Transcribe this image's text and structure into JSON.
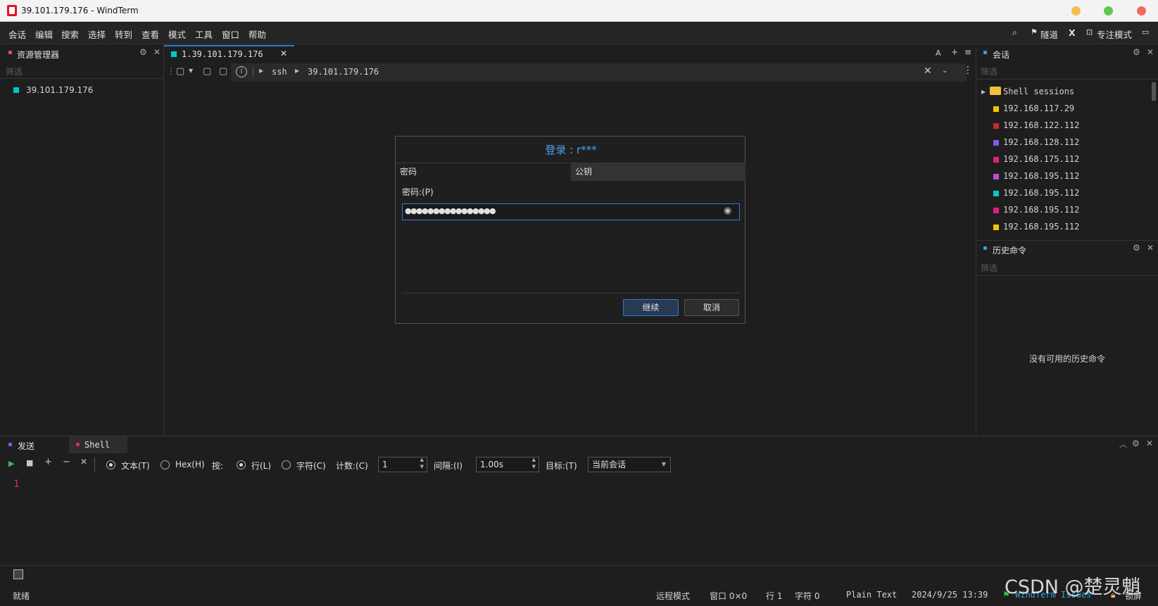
{
  "window": {
    "title": "39.101.179.176 - WindTerm"
  },
  "menu": {
    "items": [
      "会话",
      "编辑",
      "搜索",
      "选择",
      "转到",
      "查看",
      "模式",
      "工具",
      "窗口",
      "帮助"
    ],
    "tunnel_label": "隧道",
    "x_label": "X",
    "focus_label": "专注模式"
  },
  "explorer": {
    "title": "资源管理器",
    "filter_placeholder": "筛选",
    "items": [
      {
        "label": "39.101.179.176",
        "color": "#00c8c8"
      }
    ]
  },
  "tabs": {
    "active_tab": "1.39.101.179.176",
    "font_label": "A"
  },
  "addressbar": {
    "protocol": "ssh",
    "host": "39.101.179.176"
  },
  "dialog": {
    "title": "登录 : r***",
    "tab_password": "密码",
    "tab_pubkey": "公钥",
    "password_label": "密码:(P)",
    "password_value": "●●●●●●●●●●●●●●●●",
    "continue_button": "继续",
    "cancel_button": "取消"
  },
  "sessions": {
    "title": "会话",
    "filter_placeholder": "筛选",
    "folder": "Shell sessions",
    "items": [
      {
        "label": "192.168.117.29",
        "color": "#f5c400"
      },
      {
        "label": "192.168.122.112",
        "color": "#c02c2c"
      },
      {
        "label": "192.168.128.112",
        "color": "#7a5cf0"
      },
      {
        "label": "192.168.175.112",
        "color": "#e0207a"
      },
      {
        "label": "192.168.195.112",
        "color": "#b452d6"
      },
      {
        "label": "192.168.195.112",
        "color": "#00c8c8"
      },
      {
        "label": "192.168.195.112",
        "color": "#e0207a"
      },
      {
        "label": "192.168.195.112",
        "color": "#f5c400"
      }
    ]
  },
  "history": {
    "title": "历史命令",
    "filter_placeholder": "筛选",
    "empty_text": "没有可用的历史命令"
  },
  "send_panel": {
    "tab_send": "发送",
    "tab_shell": "Shell",
    "radio_text": "文本(T)",
    "radio_hex": "Hex(H)",
    "by_label": "按:",
    "radio_line": "行(L)",
    "radio_char": "字符(C)",
    "count_label": "计数:(C)",
    "count_value": "1",
    "interval_label": "间隔:(I)",
    "interval_value": "1.00s",
    "target_label": "目标:(T)",
    "target_value": "当前会话",
    "line_number": "1"
  },
  "statusbar": {
    "ready": "就绪",
    "remote_mode": "远程模式",
    "window": "窗口 0×0",
    "line": "行 1",
    "char": "字符 0",
    "syntax": "Plain Text",
    "datetime": "2024/9/25 13:39",
    "issues": "WindTerm Issues",
    "lock": "锁屏"
  },
  "watermark": "CSDN @楚灵魈"
}
